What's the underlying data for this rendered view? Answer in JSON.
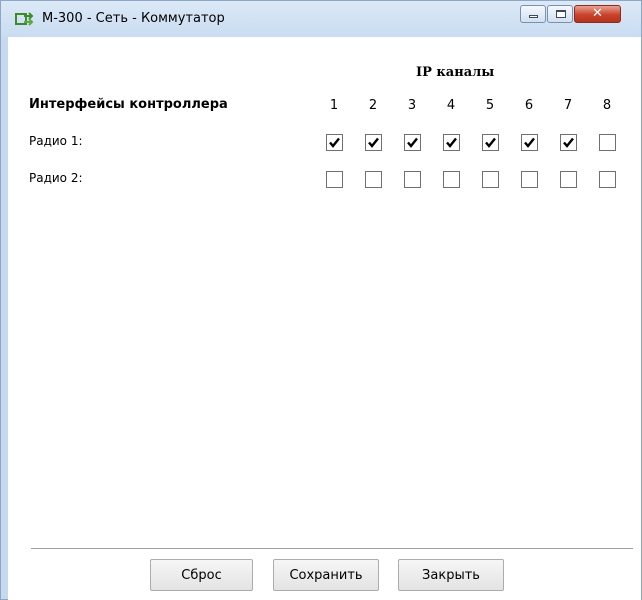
{
  "window": {
    "title": "М-300 - Сеть - Коммутатор",
    "app_icon": "network-switch-icon",
    "controls": [
      "minimize-icon",
      "maximize-icon",
      "close-icon"
    ]
  },
  "matrix": {
    "ip_channels_header": "IP каналы",
    "interfaces_header": "Интерфейсы контроллера",
    "channels": [
      "1",
      "2",
      "3",
      "4",
      "5",
      "6",
      "7",
      "8"
    ],
    "rows": [
      {
        "label": "Радио 1:",
        "checked": [
          true,
          true,
          true,
          true,
          true,
          true,
          true,
          false
        ]
      },
      {
        "label": "Радио 2:",
        "checked": [
          false,
          false,
          false,
          false,
          false,
          false,
          false,
          false
        ]
      }
    ]
  },
  "buttons": {
    "reset": "Сброс",
    "save": "Сохранить",
    "close": "Закрыть"
  },
  "colors": {
    "titlebar": "#c9dcf1",
    "close_button": "#c9432a",
    "check": "#000000"
  }
}
